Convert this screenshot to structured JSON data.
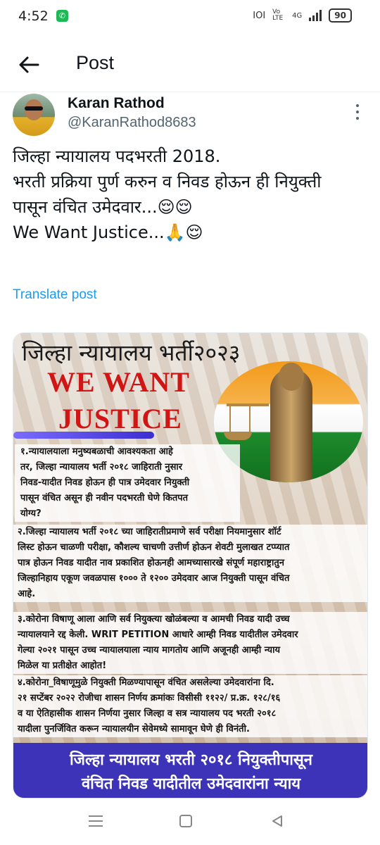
{
  "status_bar": {
    "time": "4:52",
    "app_icon": "whatsapp-icon",
    "indicators": [
      "IOI",
      "Vo LTE",
      "4G"
    ],
    "battery": "90"
  },
  "header": {
    "back_icon": "arrow-left-icon",
    "title": "Post"
  },
  "post": {
    "author_name": "Karan Rathod",
    "author_handle": "@KaranRathod8683",
    "text_lines": [
      "जिल्हा न्यायालय पदभरती 2018.",
      "भरती प्रक्रिया पुर्ण करुन व निवड होऊन ही नियुक्ती",
      "पासून वंचित उमेदवार...😌😌",
      "We Want Justice...🙏😌"
    ],
    "translate_label": "Translate post"
  },
  "image": {
    "title": "जिल्हा न्यायालय भर्ती२०२३",
    "headline_1": "WE WANT",
    "headline_2": "JUSTICE",
    "para1": [
      "१.न्यायालयाला मनुष्यबळाची आवश्यकता आहे",
      "तर, जिल्हा न्यायालय भर्ती २०१८ जाहिराती नुसार",
      "निवड-यादीत निवड होऊन ही पात्र उमेदवार नियुक्ती",
      "पासून वंचित असून ही नवीन पदभरती घेणे कितपत",
      "योग्य?"
    ],
    "para2": [
      "२.जिल्हा न्यायालय भर्ती २०१८ च्या जाहिरातीप्रमाणे सर्व परीक्षा नियमानुसार शॉर्ट",
      "लिस्ट होऊन चाळणी परीक्षा, कौशल्य चाचणी उत्तीर्ण होऊन शेवटी मुलाखत टप्प्यात",
      "पात्र होऊन निवड यादीत नाव प्रकाशित होऊनही आमच्यासारखे संपूर्ण महाराष्ट्रातुन",
      "जिल्हानिहाय एकूण जवळपास १००० ते १२०० उमेदवार आज नियुक्ती पासून वंचित",
      "आहे."
    ],
    "para3": [
      "३.कोरोना विषाणू आला आणि सर्व नियुक्त्या खोळंबल्या व आमची निवड यादी उच्च",
      "न्यायालयाने रद्द केली. WRIT PETITION आधारे आम्ही निवड यादीतील उमेदवार",
      "गेल्या २०२१ पासून उच्च न्यायालयाला न्याय मागतोय आणि अजूनही आम्ही न्याय",
      "मिळेल या प्रतीक्षेत आहोत!"
    ],
    "para4": [
      "४.कोरोना_विषाणूमुळे नियुक्ती मिळण्यापासून वंचित असलेल्या उमेदवारांना दि.",
      "२१ सप्टेंबर २०२२ रोजीचा शासन निर्णय क्रमांकः विसीसी ११२२/ प्र.क्र. १२८/१६",
      "व या ऐतिहासीक शासन निर्णया नुसार जिल्हा व सत्र न्यायालय पद भरती २०१८",
      "यादीला पुनर्जिवित करून न्यायालयीन सेवेमध्ये सामावून घेणे ही विनंती."
    ],
    "banner": [
      "जिल्हा न्यायालय भरती २०१८ नियुक्तीपासून",
      "वंचित निवड यादीतील उमेदवारांना न्याय"
    ]
  },
  "nav": {
    "menu_icon": "recent-apps-icon",
    "home_icon": "home-square-icon",
    "back_icon": "back-triangle-icon"
  },
  "colors": {
    "link": "#1d9bf0",
    "handle": "#536471",
    "headline_red": "#d11414",
    "banner_blue": "#3c33b8"
  }
}
